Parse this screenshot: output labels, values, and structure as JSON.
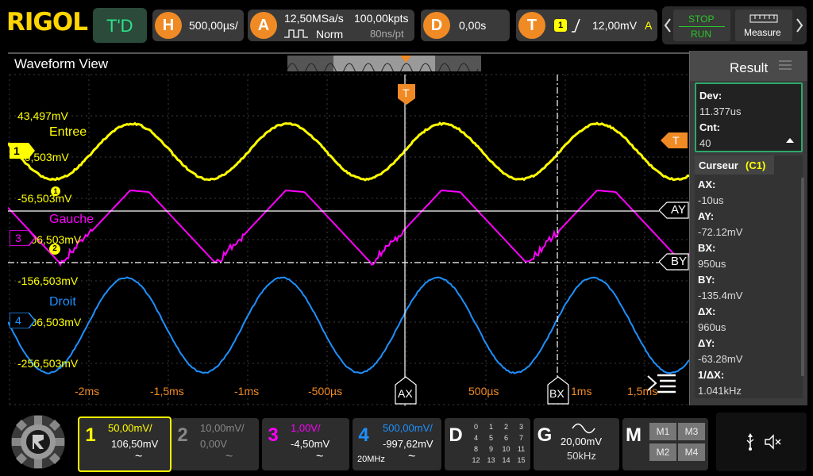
{
  "brand": "RIGOL",
  "topbar": {
    "td_label": "T'D",
    "horizontal": {
      "icon_letter": "H",
      "value": "500,00µs/"
    },
    "acquire": {
      "icon_letter": "A",
      "sample_rate": "12,50MSa/s",
      "mode": "Norm",
      "points": "100,00kpts",
      "time_per_pt": "80ns/pt"
    },
    "delay": {
      "icon_letter": "D",
      "value": "0,00s"
    },
    "trigger": {
      "icon_letter": "T",
      "channel": "1",
      "level": "12,00mV",
      "status": "A"
    },
    "stop_label": "STOP",
    "run_label": "RUN",
    "measure_label": "Measure"
  },
  "waveform_view": {
    "title": "Waveform View",
    "trigger_marker": "T",
    "labels": {
      "ch1_name": "Entree",
      "ch3_name": "Gauche",
      "ch4_name": "Droit",
      "y1": "43,497mV",
      "y2": "-6,503mV",
      "y3": "-56,503mV",
      "y4": "-106,503mV",
      "y5": "-156,503mV",
      "y6": "-206,503mV",
      "y7": "-256,503mV"
    },
    "time_labels": [
      "-2ms",
      "-1,5ms",
      "-1ms",
      "-500µs",
      "500µs",
      "1ms",
      "1,5ms"
    ],
    "cursor_labels": {
      "ax": "AX",
      "bx": "BX",
      "ay": "AY",
      "by": "BY"
    },
    "channel_markers": {
      "m1": "1",
      "m2": "2",
      "m3": "3",
      "m4": "4"
    }
  },
  "result_panel": {
    "title": "Result",
    "dev_label": "Dev:",
    "dev_value": "11.377us",
    "cnt_label": "Cnt:",
    "cnt_value": "40",
    "cursor_title": "Curseur",
    "cursor_channel": "(C1)",
    "ax_label": "AX:",
    "ax_value": "-10us",
    "ay_label": "AY:",
    "ay_value": "-72.12mV",
    "bx_label": "BX:",
    "bx_value": "950us",
    "by_label": "BY:",
    "by_value": "-135.4mV",
    "dx_label": "ΔX:",
    "dx_value": "960us",
    "dy_label": "ΔY:",
    "dy_value": "-63.28mV",
    "invdx_label": "1/ΔX:",
    "invdx_value": "1.041kHz"
  },
  "channels": [
    {
      "num": "1",
      "scale": "50,00mV/",
      "offset": "106,50mV",
      "coupling": "~",
      "color": "#ffff00"
    },
    {
      "num": "2",
      "scale": "10,00mV/",
      "offset": "0,00V",
      "coupling": "~",
      "color": "#888888"
    },
    {
      "num": "3",
      "scale": "1,00V/",
      "offset": "-4,50mV",
      "coupling": "~",
      "color": "#ff00ff"
    },
    {
      "num": "4",
      "scale": "500,00mV/",
      "offset": "-997,62mV",
      "coupling": "~",
      "extra": "20MHz",
      "color": "#1e90ff"
    }
  ],
  "digital": {
    "label": "D",
    "grid": [
      "0",
      "1",
      "2",
      "3",
      "4",
      "5",
      "6",
      "7",
      "8",
      "9",
      "10",
      "11",
      "12",
      "13",
      "14",
      "15"
    ]
  },
  "generator": {
    "label": "G",
    "amplitude": "20,00mV",
    "freq": "50kHz"
  },
  "math": {
    "label": "M",
    "items": [
      "M1",
      "M3",
      "M2",
      "M4"
    ]
  },
  "colors": {
    "ch1": "#ffff00",
    "ch3": "#ff00ff",
    "ch4": "#1e90ff",
    "accent": "#f08a24",
    "run_green": "#28c828"
  },
  "icons": {
    "usb": "usb-icon",
    "speaker": "speaker-mute-icon",
    "menu": "menu-icon",
    "home": "rigol-gear-icon"
  }
}
